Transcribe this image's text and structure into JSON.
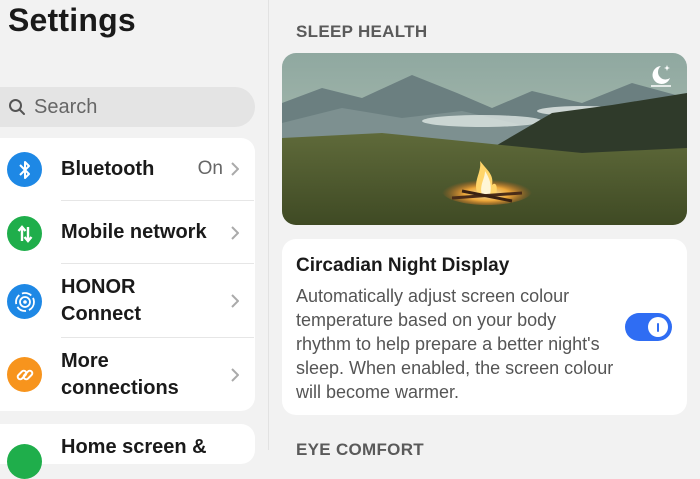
{
  "left": {
    "title": "Settings",
    "search": {
      "placeholder": "Search"
    },
    "items": [
      {
        "label": "Bluetooth",
        "value": "On",
        "color": "#1e88e5",
        "icon": "bluetooth-icon"
      },
      {
        "label": "Mobile network",
        "value": "",
        "color": "#1fae4b",
        "icon": "mobile-data-icon"
      },
      {
        "label": "HONOR Connect",
        "label_l1": "HONOR",
        "label_l2": "Connect",
        "value": "",
        "color": "#1e88e5",
        "icon": "honor-connect-icon"
      },
      {
        "label": "More connections",
        "label_l1": "More",
        "label_l2": "connections",
        "value": "",
        "color": "#f7941d",
        "icon": "link-icon"
      },
      {
        "label": "Home screen &",
        "value": "",
        "color": "#1fae4b",
        "icon": "home-screen-icon"
      }
    ]
  },
  "right": {
    "sleep_health_header": "SLEEP HEALTH",
    "hero_icon": "moon-star-icon",
    "feature": {
      "title": "Circadian Night Display",
      "description": "Automatically adjust screen colour temperature based on your body rhythm to help prepare a better night's sleep. When enabled, the screen colour will become warmer.",
      "toggle_on": true
    },
    "eye_comfort_header": "EYE COMFORT"
  },
  "colors": {
    "accent": "#2f6df3",
    "background": "#f2f2f2",
    "card": "#ffffff"
  }
}
